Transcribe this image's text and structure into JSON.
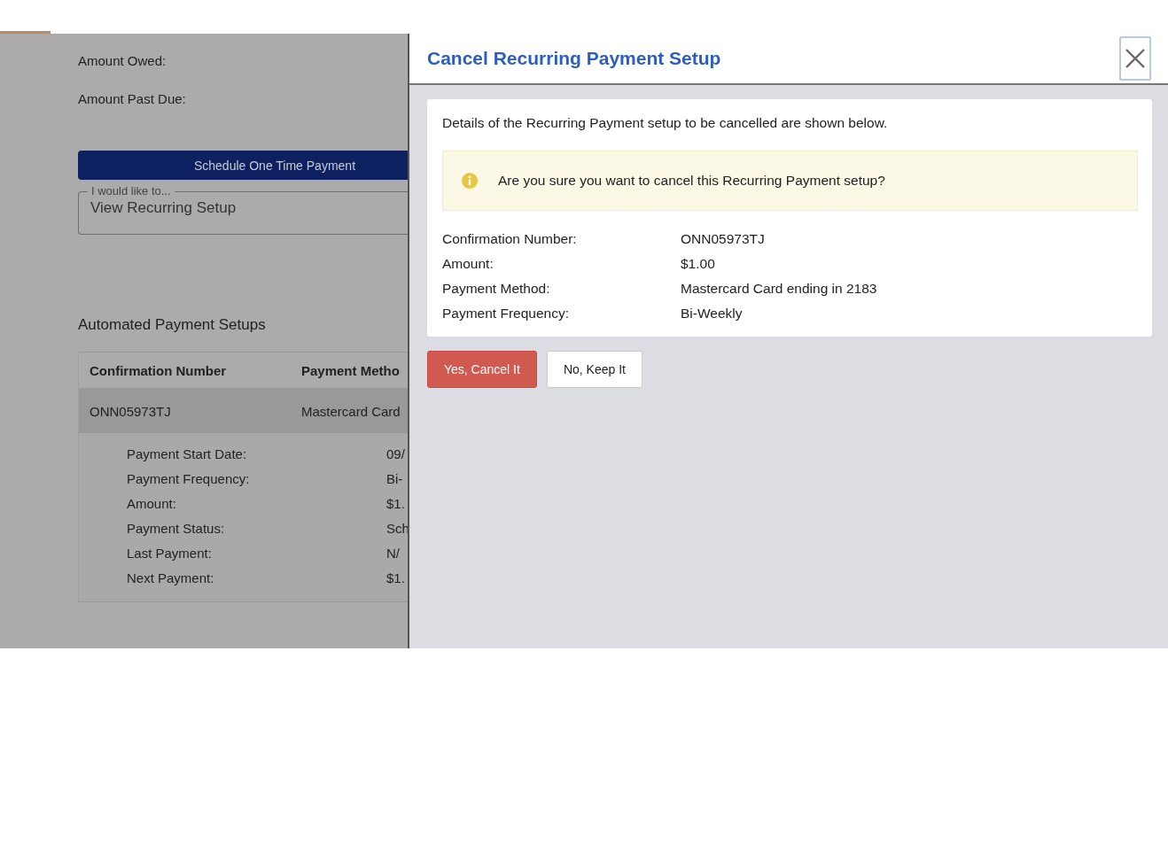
{
  "background_page": {
    "summary": [
      {
        "label": "Amount Owed:"
      },
      {
        "label": "Amount Past Due:"
      }
    ],
    "schedule_button": "Schedule One Time Payment",
    "action_select": {
      "label": "I would like to...",
      "value": "View Recurring Setup"
    },
    "section_title": "Automated Payment Setups",
    "table": {
      "columns": [
        "Confirmation Number",
        "Payment Metho"
      ],
      "rows": [
        {
          "cells": [
            "ONN05973TJ",
            "Mastercard Card"
          ],
          "expanded": true,
          "details": [
            {
              "label": "Payment Start Date:",
              "value": "09/"
            },
            {
              "label": "Payment Frequency:",
              "value": "Bi-"
            },
            {
              "label": "Amount:",
              "value": "$1."
            },
            {
              "label": "Payment Status:",
              "value": "Sch"
            },
            {
              "label": "Last Payment:",
              "value": "N/"
            },
            {
              "label": "Next Payment:",
              "value": "$1."
            }
          ]
        }
      ]
    }
  },
  "dialog": {
    "title": "Cancel Recurring Payment Setup",
    "intro": "Details of the Recurring Payment setup to be cancelled are shown below.",
    "warning": "Are you sure you want to cancel this Recurring Payment setup?",
    "details": [
      {
        "label": "Confirmation Number:",
        "value": "ONN05973TJ"
      },
      {
        "label": "Amount:",
        "value": "$1.00"
      },
      {
        "label": "Payment Method:",
        "value": "Mastercard Card ending in 2183"
      },
      {
        "label": "Payment Frequency:",
        "value": "Bi-Weekly"
      }
    ],
    "buttons": [
      {
        "label": "Yes, Cancel It",
        "kind": "danger"
      },
      {
        "label": "No, Keep It",
        "kind": "default"
      }
    ]
  }
}
